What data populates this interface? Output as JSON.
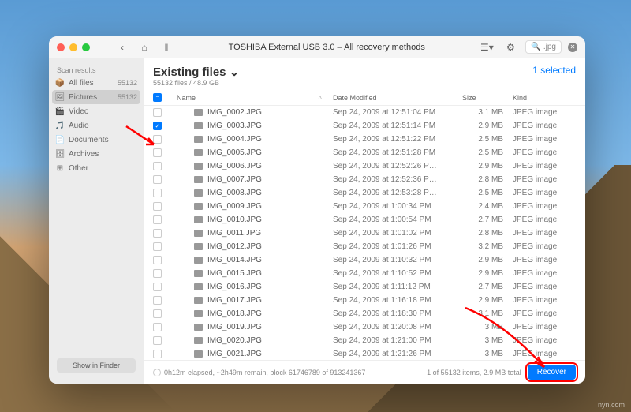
{
  "titlebar": {
    "title": "TOSHIBA External USB 3.0 – All recovery methods",
    "search_value": ".jpg"
  },
  "sidebar": {
    "header": "Scan results",
    "items": [
      {
        "icon": "📦",
        "label": "All files",
        "count": "55132"
      },
      {
        "icon": "🖼",
        "label": "Pictures",
        "count": "55132"
      },
      {
        "icon": "🎬",
        "label": "Video",
        "count": ""
      },
      {
        "icon": "🎵",
        "label": "Audio",
        "count": ""
      },
      {
        "icon": "📄",
        "label": "Documents",
        "count": ""
      },
      {
        "icon": "🗄",
        "label": "Archives",
        "count": ""
      },
      {
        "icon": "⊞",
        "label": "Other",
        "count": ""
      }
    ],
    "footer_btn": "Show in Finder"
  },
  "main": {
    "title": "Existing files ⌄",
    "subtitle": "55132 files / 48.9 GB",
    "selected": "1 selected",
    "columns": {
      "name": "Name",
      "date": "Date Modified",
      "size": "Size",
      "kind": "Kind"
    },
    "rows": [
      {
        "checked": false,
        "name": "IMG_0002.JPG",
        "date": "Sep 24, 2009 at 12:51:04 PM",
        "size": "3.1 MB",
        "kind": "JPEG image"
      },
      {
        "checked": true,
        "name": "IMG_0003.JPG",
        "date": "Sep 24, 2009 at 12:51:14 PM",
        "size": "2.9 MB",
        "kind": "JPEG image"
      },
      {
        "checked": false,
        "name": "IMG_0004.JPG",
        "date": "Sep 24, 2009 at 12:51:22 PM",
        "size": "2.5 MB",
        "kind": "JPEG image"
      },
      {
        "checked": false,
        "name": "IMG_0005.JPG",
        "date": "Sep 24, 2009 at 12:51:28 PM",
        "size": "2.5 MB",
        "kind": "JPEG image"
      },
      {
        "checked": false,
        "name": "IMG_0006.JPG",
        "date": "Sep 24, 2009 at 12:52:26 P…",
        "size": "2.9 MB",
        "kind": "JPEG image"
      },
      {
        "checked": false,
        "name": "IMG_0007.JPG",
        "date": "Sep 24, 2009 at 12:52:36 P…",
        "size": "2.8 MB",
        "kind": "JPEG image"
      },
      {
        "checked": false,
        "name": "IMG_0008.JPG",
        "date": "Sep 24, 2009 at 12:53:28 P…",
        "size": "2.5 MB",
        "kind": "JPEG image"
      },
      {
        "checked": false,
        "name": "IMG_0009.JPG",
        "date": "Sep 24, 2009 at 1:00:34 PM",
        "size": "2.4 MB",
        "kind": "JPEG image"
      },
      {
        "checked": false,
        "name": "IMG_0010.JPG",
        "date": "Sep 24, 2009 at 1:00:54 PM",
        "size": "2.7 MB",
        "kind": "JPEG image"
      },
      {
        "checked": false,
        "name": "IMG_0011.JPG",
        "date": "Sep 24, 2009 at 1:01:02 PM",
        "size": "2.8 MB",
        "kind": "JPEG image"
      },
      {
        "checked": false,
        "name": "IMG_0012.JPG",
        "date": "Sep 24, 2009 at 1:01:26 PM",
        "size": "3.2 MB",
        "kind": "JPEG image"
      },
      {
        "checked": false,
        "name": "IMG_0014.JPG",
        "date": "Sep 24, 2009 at 1:10:32 PM",
        "size": "2.9 MB",
        "kind": "JPEG image"
      },
      {
        "checked": false,
        "name": "IMG_0015.JPG",
        "date": "Sep 24, 2009 at 1:10:52 PM",
        "size": "2.9 MB",
        "kind": "JPEG image"
      },
      {
        "checked": false,
        "name": "IMG_0016.JPG",
        "date": "Sep 24, 2009 at 1:11:12 PM",
        "size": "2.7 MB",
        "kind": "JPEG image"
      },
      {
        "checked": false,
        "name": "IMG_0017.JPG",
        "date": "Sep 24, 2009 at 1:16:18 PM",
        "size": "2.9 MB",
        "kind": "JPEG image"
      },
      {
        "checked": false,
        "name": "IMG_0018.JPG",
        "date": "Sep 24, 2009 at 1:18:30 PM",
        "size": "3.1 MB",
        "kind": "JPEG image"
      },
      {
        "checked": false,
        "name": "IMG_0019.JPG",
        "date": "Sep 24, 2009 at 1:20:08 PM",
        "size": "3 MB",
        "kind": "JPEG image"
      },
      {
        "checked": false,
        "name": "IMG_0020.JPG",
        "date": "Sep 24, 2009 at 1:21:00 PM",
        "size": "3 MB",
        "kind": "JPEG image"
      },
      {
        "checked": false,
        "name": "IMG_0021.JPG",
        "date": "Sep 24, 2009 at 1:21:26 PM",
        "size": "3 MB",
        "kind": "JPEG image"
      }
    ],
    "status": "0h12m elapsed, ~2h49m remain, block 61746789 of 913241367",
    "status_right": "1 of 55132 items, 2.9 MB total",
    "recover_btn": "Recover"
  },
  "watermark": "nyn.com"
}
